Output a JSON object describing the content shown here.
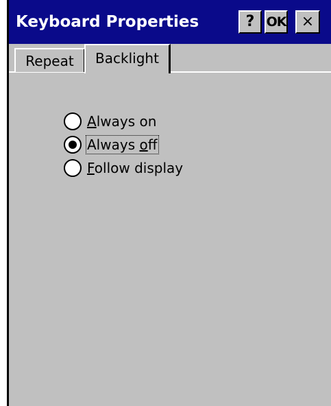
{
  "window": {
    "title": "Keyboard Properties",
    "buttons": {
      "help": "?",
      "ok": "OK",
      "close": "×"
    }
  },
  "tabs": [
    {
      "label": "Repeat",
      "active": false
    },
    {
      "label": "Backlight",
      "active": true
    }
  ],
  "backlight": {
    "options": [
      {
        "mnemonic": "A",
        "rest": "lways on",
        "selected": false
      },
      {
        "mnemonic": "",
        "pre": "Always ",
        "mid": "o",
        "post": "ff",
        "selected": true
      },
      {
        "mnemonic": "F",
        "rest": "ollow display",
        "selected": false
      }
    ]
  },
  "colors": {
    "titlebar": "#0a0a8a",
    "face": "#c0c0c0"
  }
}
